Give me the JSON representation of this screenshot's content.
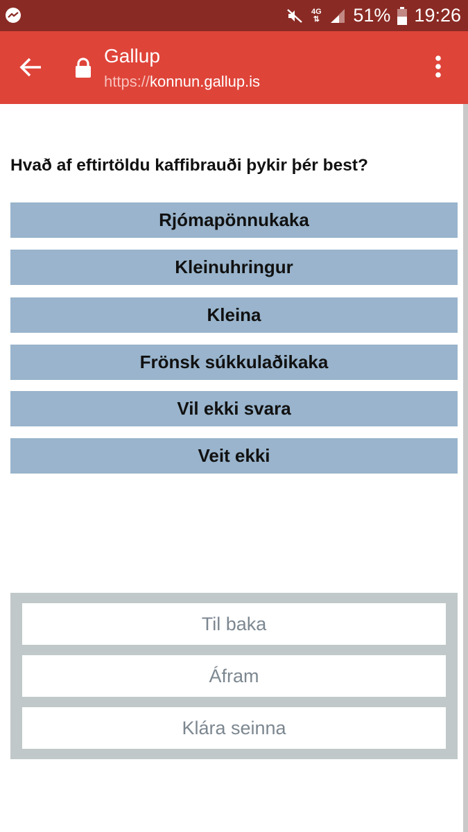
{
  "status_bar": {
    "left_icon": "messenger-icon",
    "network_type": "4G",
    "battery_percent": "51%",
    "time": "19:26",
    "icons": [
      "mute-icon",
      "network-4g-icon",
      "signal-icon",
      "battery-icon"
    ]
  },
  "app_bar": {
    "title": "Gallup",
    "url_scheme": "https://",
    "url_host": "konnun.gallup.is",
    "back_icon": "arrow-left-icon",
    "lock_icon": "lock-icon",
    "menu_icon": "more-vert-icon",
    "color": "#df4439"
  },
  "survey": {
    "question": "Hvað af eftirtöldu kaffibrauði þykir þér best?",
    "options": [
      "Rjómapönnukaka",
      "Kleinuhringur",
      "Kleina",
      "Frönsk súkkulaðikaka",
      "Vil ekki svara",
      "Veit ekki"
    ],
    "option_color": "#99b4cc"
  },
  "navigation": {
    "back_label": "Til baka",
    "next_label": "Áfram",
    "later_label": "Klára seinna"
  }
}
